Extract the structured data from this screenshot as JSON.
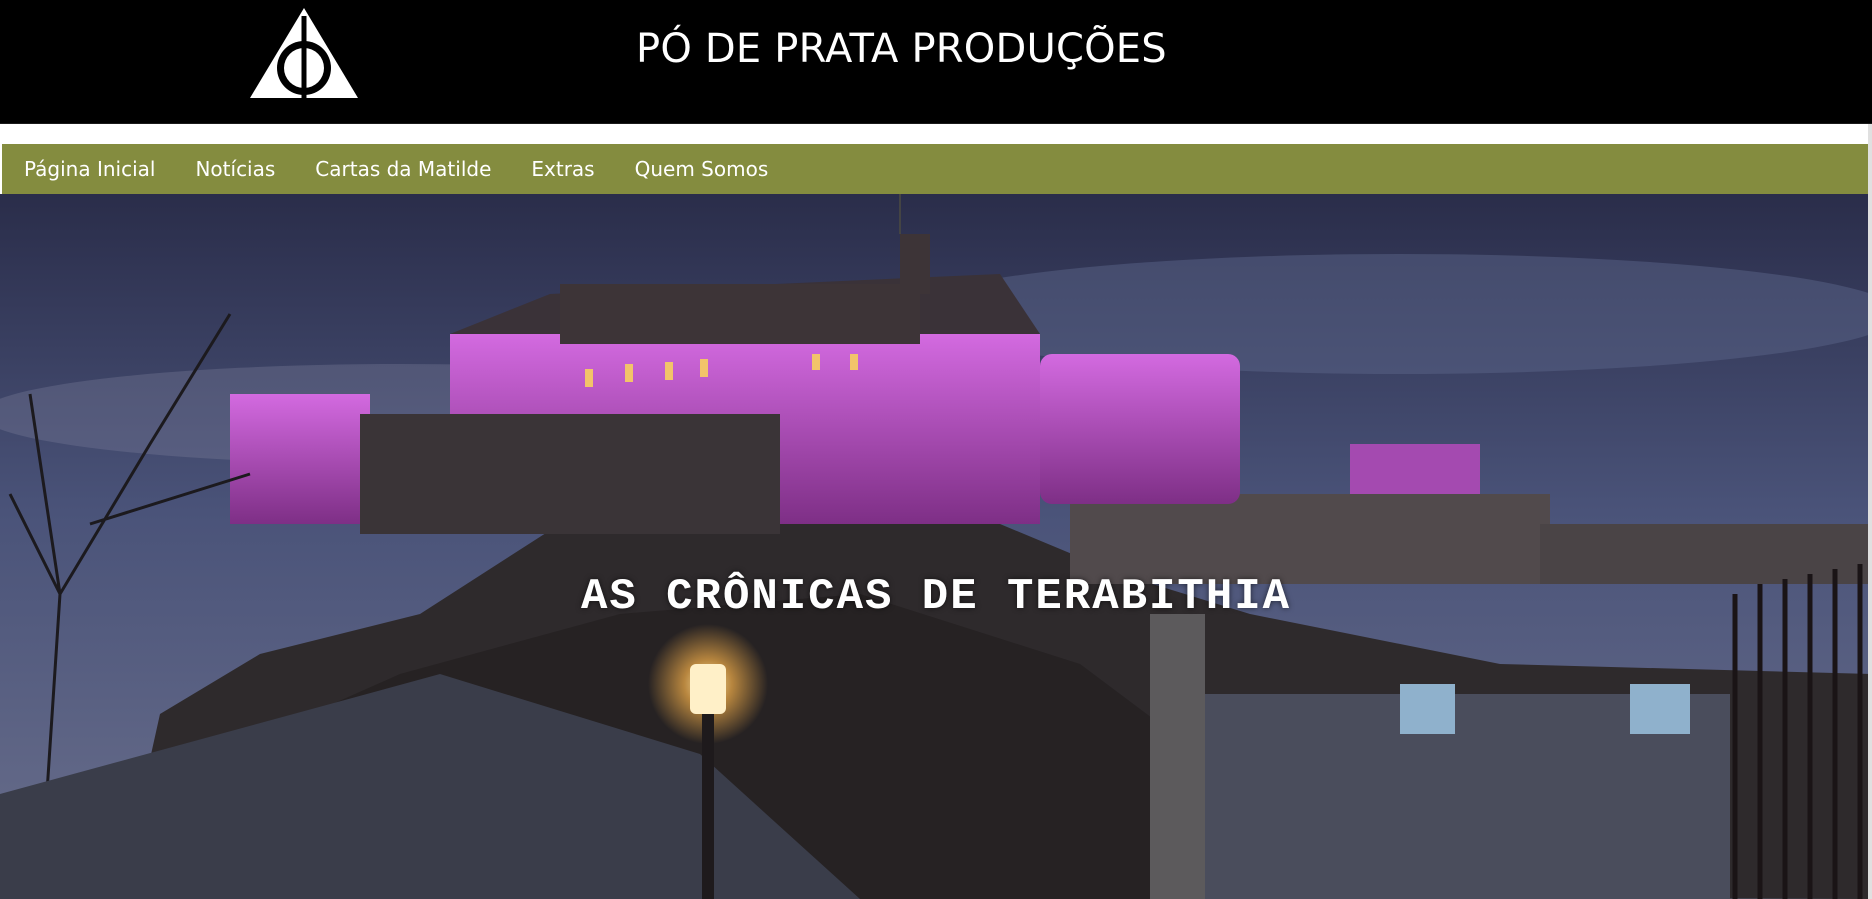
{
  "header": {
    "logo_icon": "deathly-hallows-icon",
    "title": "PÓ DE PRATA PRODUÇÕES"
  },
  "nav": {
    "items": [
      {
        "label": "Página Inicial"
      },
      {
        "label": "Notícias"
      },
      {
        "label": "Cartas da Matilde"
      },
      {
        "label": "Extras"
      },
      {
        "label": "Quem Somos"
      }
    ]
  },
  "hero": {
    "title": "AS CRÔNICAS DE TERABITHIA",
    "image": "castle-at-night-photo"
  },
  "colors": {
    "header_bg": "#000000",
    "nav_bg": "#848c3f",
    "text": "#ffffff",
    "castle_light": "#c04fd0"
  }
}
